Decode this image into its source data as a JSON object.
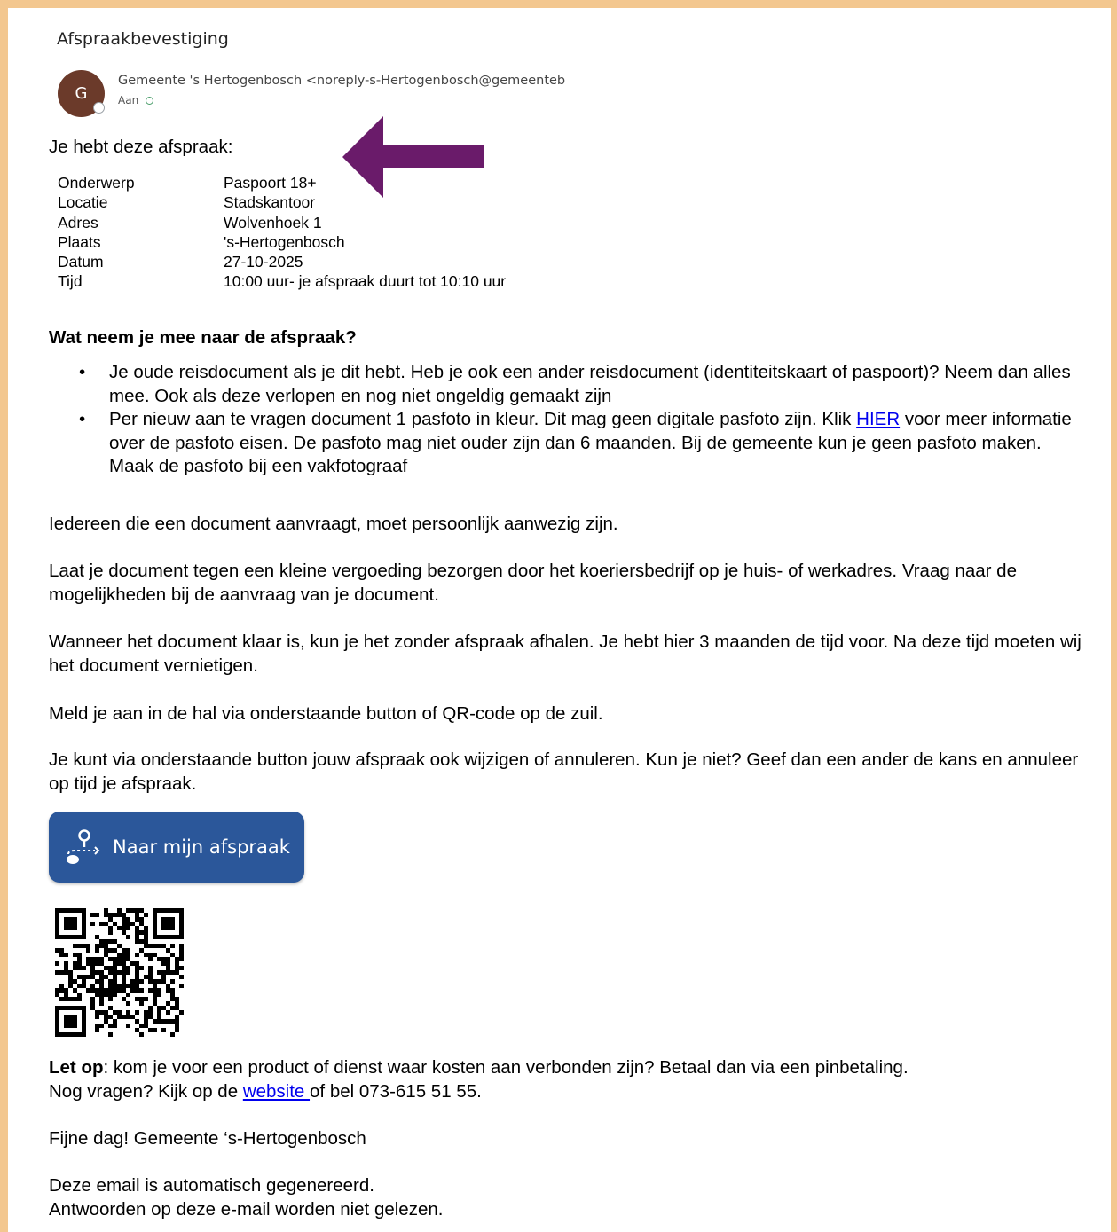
{
  "email": {
    "subject": "Afspraakbevestiging",
    "avatar_initial": "G",
    "sender": "Gemeente 's Hertogenbosch <noreply-s-Hertogenbosch@gemeenteb",
    "to_label": "Aan"
  },
  "appointment": {
    "intro": "Je hebt deze afspraak:",
    "rows": [
      {
        "label": "Onderwerp",
        "value": "Paspoort 18+"
      },
      {
        "label": "Locatie",
        "value": "Stadskantoor"
      },
      {
        "label": "Adres",
        "value": "Wolvenhoek 1"
      },
      {
        "label": "Plaats",
        "value": "'s-Hertogenbosch"
      },
      {
        "label": "Datum",
        "value": "27-10-2025"
      },
      {
        "label": "Tijd",
        "value": "10:00 uur- je afspraak duurt tot 10:10 uur"
      }
    ]
  },
  "bring": {
    "heading": "Wat neem je mee naar de afspraak?",
    "bullet1": "Je oude reisdocument als je dit hebt. Heb je ook een ander reisdocument (identiteitskaart of paspoort)? Neem dan alles mee. Ook als deze verlopen en nog niet ongeldig gemaakt zijn",
    "bullet2_before": "Per nieuw aan te vragen document 1 pasfoto in kleur. Dit mag geen digitale pasfoto zijn. Klik ",
    "bullet2_link": "HIER",
    "bullet2_after": " voor meer informatie over de pasfoto eisen. De pasfoto mag niet ouder zijn dan 6 maanden. Bij de gemeente kun je geen pasfoto maken. Maak de pasfoto bij een vakfotograaf"
  },
  "paragraphs": {
    "p1": "Iedereen die een document aanvraagt, moet persoonlijk aanwezig zijn.",
    "p2": "Laat je document tegen een kleine vergoeding bezorgen door het koeriersbedrijf op je huis- of werkadres. Vraag naar de mogelijkheden bij de aanvraag van je document.",
    "p3": "Wanneer het document klaar is, kun je het zonder afspraak afhalen. Je hebt hier 3 maanden de tijd voor. Na deze tijd moeten wij het document vernietigen.",
    "p4": "Meld je aan in de hal via onderstaande button of QR-code op de zuil.",
    "p5": "Je kunt via onderstaande button jouw afspraak ook wijzigen of annuleren. Kun je niet? Geef dan een ander de kans en annuleer op tijd je afspraak."
  },
  "button": {
    "label": "Naar mijn afspraak",
    "icon": "location-route-icon"
  },
  "footer": {
    "letop_bold": "Let op",
    "letop_text": ": kom je voor een product of dienst waar kosten aan verbonden zijn? Betaal dan via een pinbetaling.",
    "questions_before": "Nog vragen? Kijk op de ",
    "questions_link": "website ",
    "questions_after": "of bel 073-615 51 55.",
    "greeting": "Fijne dag! Gemeente ‘s-Hertogenbosch",
    "auto1": "Deze email is automatisch gegenereerd.",
    "auto2": "Antwoorden op deze e-mail worden niet gelezen."
  },
  "colors": {
    "frame": "#f3c78f",
    "arrow": "#6a1b6a",
    "button": "#2b579a",
    "link": "#0000ee",
    "avatar": "#6b3a2a"
  }
}
